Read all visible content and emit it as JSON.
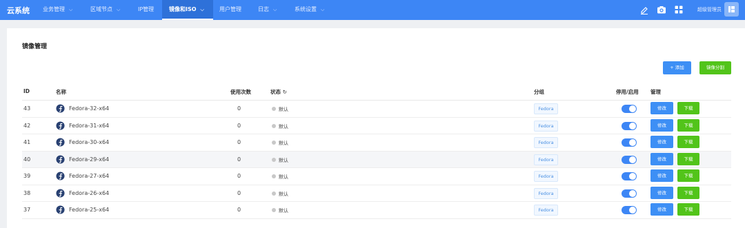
{
  "app": {
    "brand": "云系统",
    "username": "超级管理员"
  },
  "nav": [
    {
      "label": "业务管理",
      "chevron": true
    },
    {
      "label": "区域节点",
      "chevron": true
    },
    {
      "label": "IP管理",
      "chevron": false
    },
    {
      "label": "镜像和ISO",
      "chevron": true,
      "active": true
    },
    {
      "label": "用户管理",
      "chevron": false
    },
    {
      "label": "日志",
      "chevron": true
    },
    {
      "label": "系统设置",
      "chevron": true
    }
  ],
  "top_icons": [
    "edit-icon",
    "camera-icon",
    "grid-icon"
  ],
  "page": {
    "title": "镜像管理",
    "add_button": "+ 添加",
    "split_button": "镜像分割"
  },
  "table": {
    "headers": {
      "id": "ID",
      "name": "名称",
      "uses": "使用次数",
      "status": "状态",
      "group": "分组",
      "enable": "停用/启用",
      "manage": "管理"
    },
    "rows": [
      {
        "id": "43",
        "name": "Fedora-32-x64",
        "uses": "0",
        "status": "默认",
        "group": "Fedora",
        "enabled": true,
        "edit": "修改",
        "download": "下载"
      },
      {
        "id": "42",
        "name": "Fedora-31-x64",
        "uses": "0",
        "status": "默认",
        "group": "Fedora",
        "enabled": true,
        "edit": "修改",
        "download": "下载"
      },
      {
        "id": "41",
        "name": "Fedora-30-x64",
        "uses": "0",
        "status": "默认",
        "group": "Fedora",
        "enabled": true,
        "edit": "修改",
        "download": "下载"
      },
      {
        "id": "40",
        "name": "Fedora-29-x64",
        "uses": "0",
        "status": "默认",
        "group": "Fedora",
        "enabled": true,
        "edit": "修改",
        "download": "下载"
      },
      {
        "id": "39",
        "name": "Fedora-27-x64",
        "uses": "0",
        "status": "默认",
        "group": "Fedora",
        "enabled": true,
        "edit": "修改",
        "download": "下载"
      },
      {
        "id": "38",
        "name": "Fedora-26-x64",
        "uses": "0",
        "status": "默认",
        "group": "Fedora",
        "enabled": true,
        "edit": "修改",
        "download": "下载"
      },
      {
        "id": "37",
        "name": "Fedora-25-x64",
        "uses": "0",
        "status": "默认",
        "group": "Fedora",
        "enabled": true,
        "edit": "修改",
        "download": "下载"
      }
    ]
  },
  "colors": {
    "primary": "#3d86f5",
    "success": "#52c41a"
  }
}
